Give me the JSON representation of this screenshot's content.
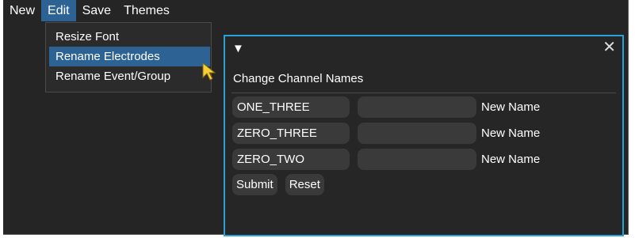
{
  "menubar": {
    "items": [
      {
        "label": "New"
      },
      {
        "label": "Edit",
        "active": true
      },
      {
        "label": "Save"
      },
      {
        "label": "Themes"
      }
    ]
  },
  "edit_menu": {
    "items": [
      {
        "label": "Resize Font"
      },
      {
        "label": "Rename Electrodes",
        "highlighted": true
      },
      {
        "label": "Rename Event/Group"
      }
    ]
  },
  "panel": {
    "toggle_icon": "triangle-down-icon",
    "close_icon": "close-icon",
    "title": "Change Channel Names",
    "rows": [
      {
        "current_name": "ONE_THREE",
        "new_value": "",
        "label": "New Name"
      },
      {
        "current_name": "ZERO_THREE",
        "new_value": "",
        "label": "New Name"
      },
      {
        "current_name": "ZERO_TWO",
        "new_value": "",
        "label": "New Name"
      }
    ],
    "submit_label": "Submit",
    "reset_label": "Reset"
  },
  "colors": {
    "background": "#252526",
    "menu_highlight": "#2d6394",
    "panel_border": "#2aa3d4",
    "field_bg": "#3a3a3a",
    "cursor": "#f5d03b"
  }
}
